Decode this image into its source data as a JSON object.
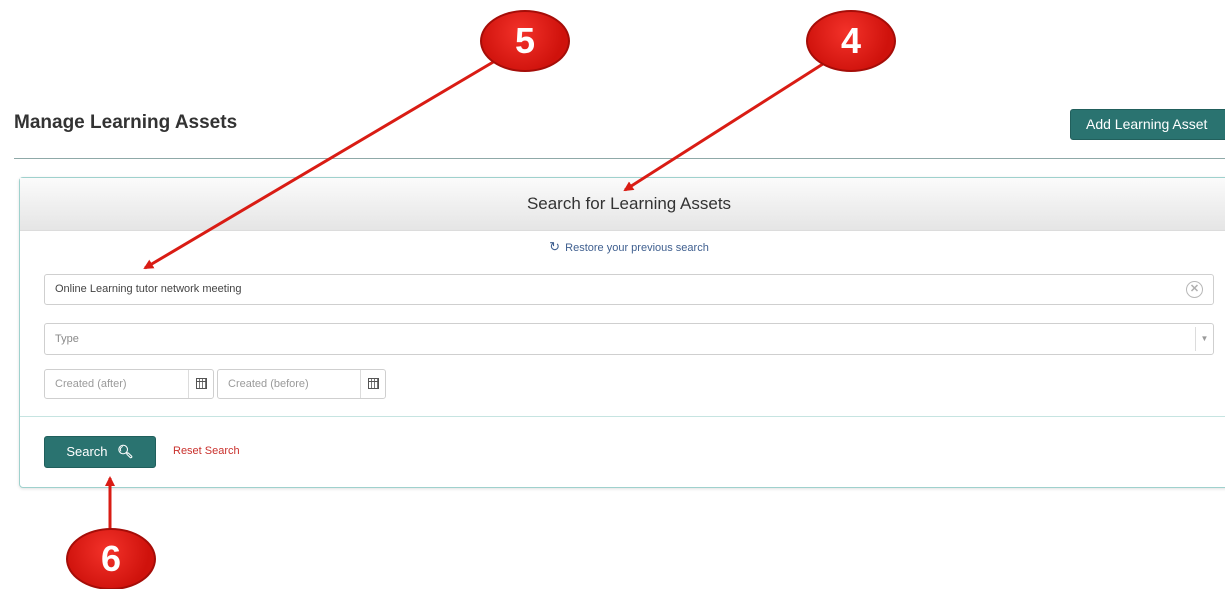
{
  "header": {
    "title": "Manage Learning Assets",
    "add_button_label": "Add Learning Asset"
  },
  "search_panel": {
    "title": "Search for Learning Assets",
    "restore_link": "Restore your previous search",
    "search_input_value": "Online Learning tutor network meeting",
    "type_select_placeholder": "Type",
    "created_after_placeholder": "Created (after)",
    "created_before_placeholder": "Created (before)",
    "search_button_label": "Search",
    "reset_link": "Reset Search"
  },
  "annotations": {
    "callout_4": "4",
    "callout_5": "5",
    "callout_6": "6"
  },
  "icons": {
    "restore": "refresh-icon",
    "clear": "clear-circle-icon",
    "dropdown": "caret-down-icon",
    "calendar": "calendar-icon",
    "search": "magnifier-icon"
  },
  "colors": {
    "primary_button": "#2a7370",
    "reset_link": "#c9302c",
    "callout": "#e0201a"
  }
}
